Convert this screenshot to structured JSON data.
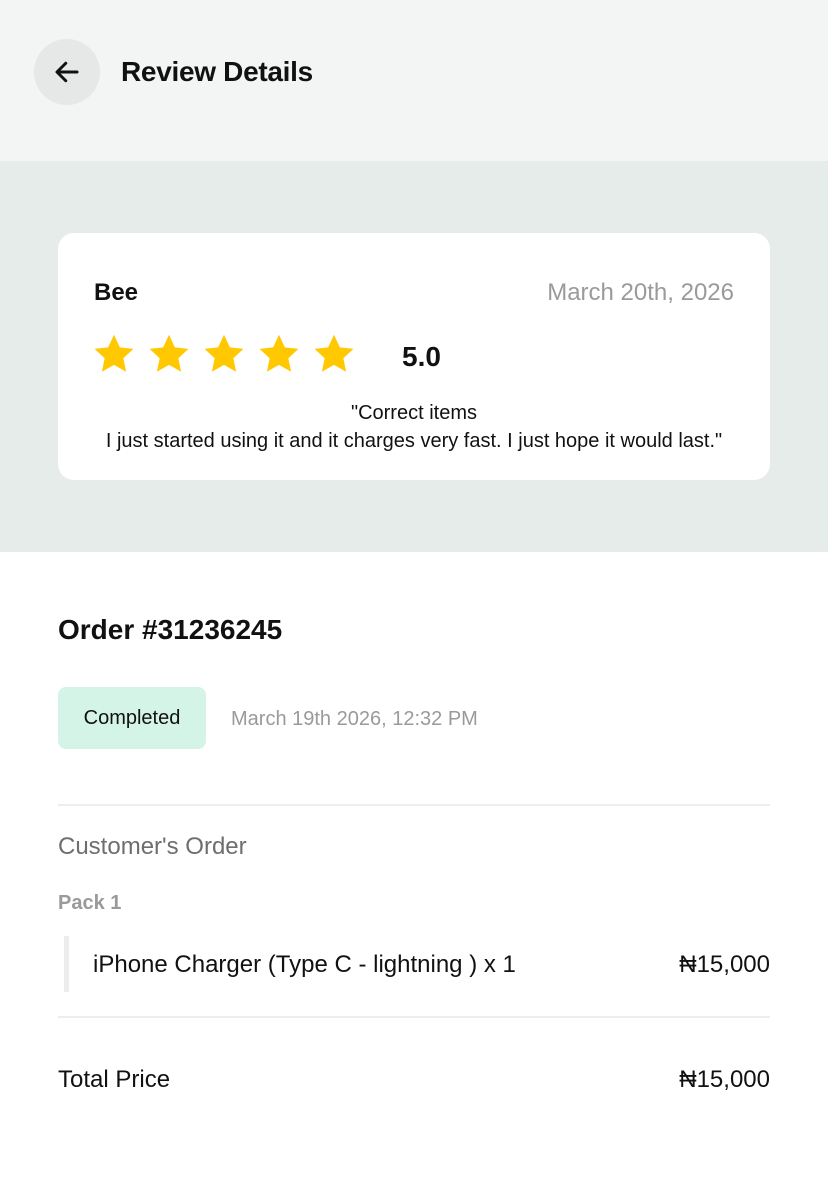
{
  "header": {
    "title": "Review Details",
    "back_icon": "arrow-left-icon"
  },
  "review": {
    "reviewer": "Bee",
    "date": "March 20th, 2026",
    "stars": 5,
    "max_stars": 5,
    "star_icon": "star-icon",
    "star_color": "#FFC800",
    "rating": "5.0",
    "text": "\"Correct items\nI just started using it and it charges very fast. I just hope it would last.\""
  },
  "order": {
    "number": "Order #31236245",
    "status": "Completed",
    "status_color": "#D4F4E8",
    "timestamp": "March 19th 2026, 12:32 PM",
    "customer_order_label": "Customer's Order",
    "pack_label": "Pack 1",
    "items": [
      {
        "name": "iPhone Charger (Type C - lightning ) x 1",
        "price": "₦15,000"
      }
    ],
    "total_label": "Total Price",
    "total_value": "₦15,000"
  }
}
